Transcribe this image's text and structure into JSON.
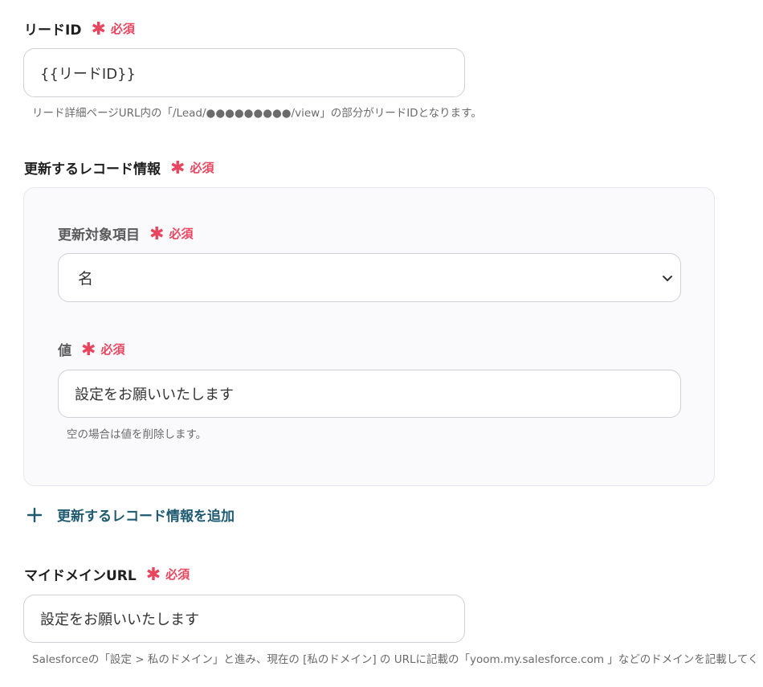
{
  "required_label": "必須",
  "lead_id": {
    "label": "リードID",
    "value": "{{リードID}}",
    "hint": "リード詳細ページURL内の「/Lead/●●●●●●●●●/view」の部分がリードIDとなります。"
  },
  "record_info": {
    "label": "更新するレコード情報",
    "field": {
      "label": "更新対象項目",
      "selected": "名"
    },
    "value_field": {
      "label": "値",
      "value": "設定をお願いいたします",
      "hint": "空の場合は値を削除します。"
    },
    "add_label": "更新するレコード情報を追加"
  },
  "domain_url": {
    "label": "マイドメインURL",
    "value": "設定をお願いいたします",
    "hint": "Salesforceの「設定 > 私のドメイン」と進み、現在の [私のドメイン] の URLに記載の「yoom.my.salesforce.com 」などのドメインを記載してください。"
  },
  "colors": {
    "required": "#e8455f",
    "add_link": "#1d5a70",
    "panel_bg": "#faf9fc"
  }
}
